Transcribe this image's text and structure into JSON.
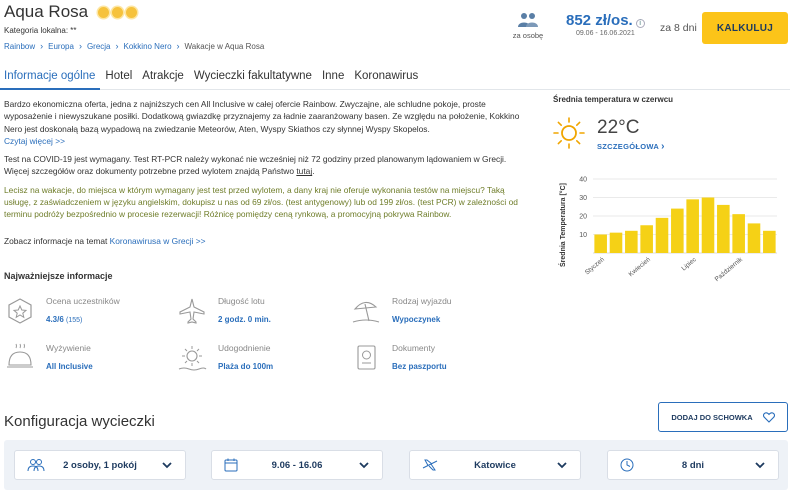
{
  "header": {
    "hotel_name": "Aqua Rosa",
    "local_category": "Kategoria lokalna: **",
    "breadcrumb": [
      "Rainbow",
      "Europa",
      "Grecja",
      "Kokkino Nero",
      "Wakacje w Aqua Rosa"
    ],
    "persons_label": "za osobę",
    "price": "852 zł/os.",
    "price_info_icon": "i",
    "price_dates": "09.06 - 16.06.2021",
    "days": "za 8 dni",
    "calculate_button": "KALKULUJ",
    "star_icon": "sun-star-icon",
    "accent_color": "#2a6ebb",
    "cta_color": "#fcc419"
  },
  "tabs": [
    "Informacje ogólne",
    "Hotel",
    "Atrakcje",
    "Wycieczki fakultatywne",
    "Inne",
    "Koronawirus"
  ],
  "description": {
    "para1": "Bardzo ekonomiczna oferta, jedna z najniższych cen All Inclusive w całej ofercie Rainbow. Zwyczajne, ale schludne pokoje, proste wyposażenie i niewyszukane posiłki. Dodatkową gwiazdkę przyznajemy za ładnie zaaranżowany basen. Ze względu na położenie, Kokkino Nero jest doskonałą bazą wypadową na zwiedzanie Meteorów, Aten, Wyspy Skiathos czy słynnej Wyspy Skopelos.",
    "read_more": "Czytaj więcej >>",
    "covid1": "Test na COVID-19 jest wymagany. Test RT-PCR należy wykonać nie wcześniej niż 72 godziny przed planowanym lądowaniem w Grecji. Więcej szczegółów oraz dokumenty potrzebne przed wylotem znajdą Państwo ",
    "covid1_link": "tutaj",
    "covid1_end": ".",
    "covid2": "Lecisz na wakacje, do miejsca w którym wymagany jest test przed wylotem, a dany kraj nie oferuje wykonania testów na miejscu? Taką usługę, z zaświadczeniem w języku angielskim, dokupisz u nas od 69 zł/os. (test antygenowy) lub od 199 zł/os. (test PCR) w zależności od terminu podróży bezpośrednio w procesie rezerwacji! Różnicę pomiędzy ceną rynkową, a promocyjną pokrywa Rainbow.",
    "corona_prefix": "Zobacz informacje na temat ",
    "corona_link": "Koronawirusa w Grecji >>"
  },
  "important": {
    "title": "Najważniejsze informacje",
    "items": [
      {
        "label": "Ocena uczestników",
        "value": "4.3/6",
        "extra": "(155)",
        "icon": "rating-badge-icon"
      },
      {
        "label": "Długość lotu",
        "value": "2 godz. 0 min.",
        "icon": "plane-icon"
      },
      {
        "label": "Rodzaj wyjazdu",
        "value": "Wypoczynek",
        "icon": "beach-umbrella-icon"
      },
      {
        "label": "Wyżywienie",
        "value": "All Inclusive",
        "icon": "food-cloche-icon"
      },
      {
        "label": "Udogodnienie",
        "value": "Plaża do 100m",
        "icon": "sun-beach-icon"
      },
      {
        "label": "Dokumenty",
        "value": "Bez paszportu",
        "icon": "passport-icon"
      }
    ]
  },
  "temperature": {
    "title": "Średnia temperatura w czerwcu",
    "current": "22°C",
    "details_link": "SZCZEGÓŁOWA",
    "weather_icon": "sun-icon",
    "bar_color": "#f5d116"
  },
  "chart_data": {
    "type": "bar",
    "ylabel": "Średnia Temperatura [°C]",
    "ylim": [
      0,
      40
    ],
    "yticks": [
      10,
      20,
      30,
      40
    ],
    "xtick_labels": [
      "Styczeń",
      "Kwiecień",
      "Lipiec",
      "Październik"
    ],
    "xtick_positions": [
      0,
      3,
      6,
      9
    ],
    "categories": [
      "1",
      "2",
      "3",
      "4",
      "5",
      "6",
      "7",
      "8",
      "9",
      "10",
      "11",
      "12"
    ],
    "values": [
      10,
      11,
      12,
      15,
      19,
      24,
      29,
      30,
      26,
      21,
      16,
      12
    ],
    "grid": true
  },
  "config": {
    "title": "Konfiguracja wycieczki",
    "clipboard_button": "DODAJ DO SCHOWKA",
    "fields": [
      {
        "value": "2 osoby, 1 pokój",
        "icon": "people-icon"
      },
      {
        "value": "9.06 - 16.06",
        "icon": "calendar-icon"
      },
      {
        "value": "Katowice",
        "icon": "plane-icon"
      },
      {
        "value": "8 dni",
        "icon": "clock-icon"
      }
    ]
  }
}
